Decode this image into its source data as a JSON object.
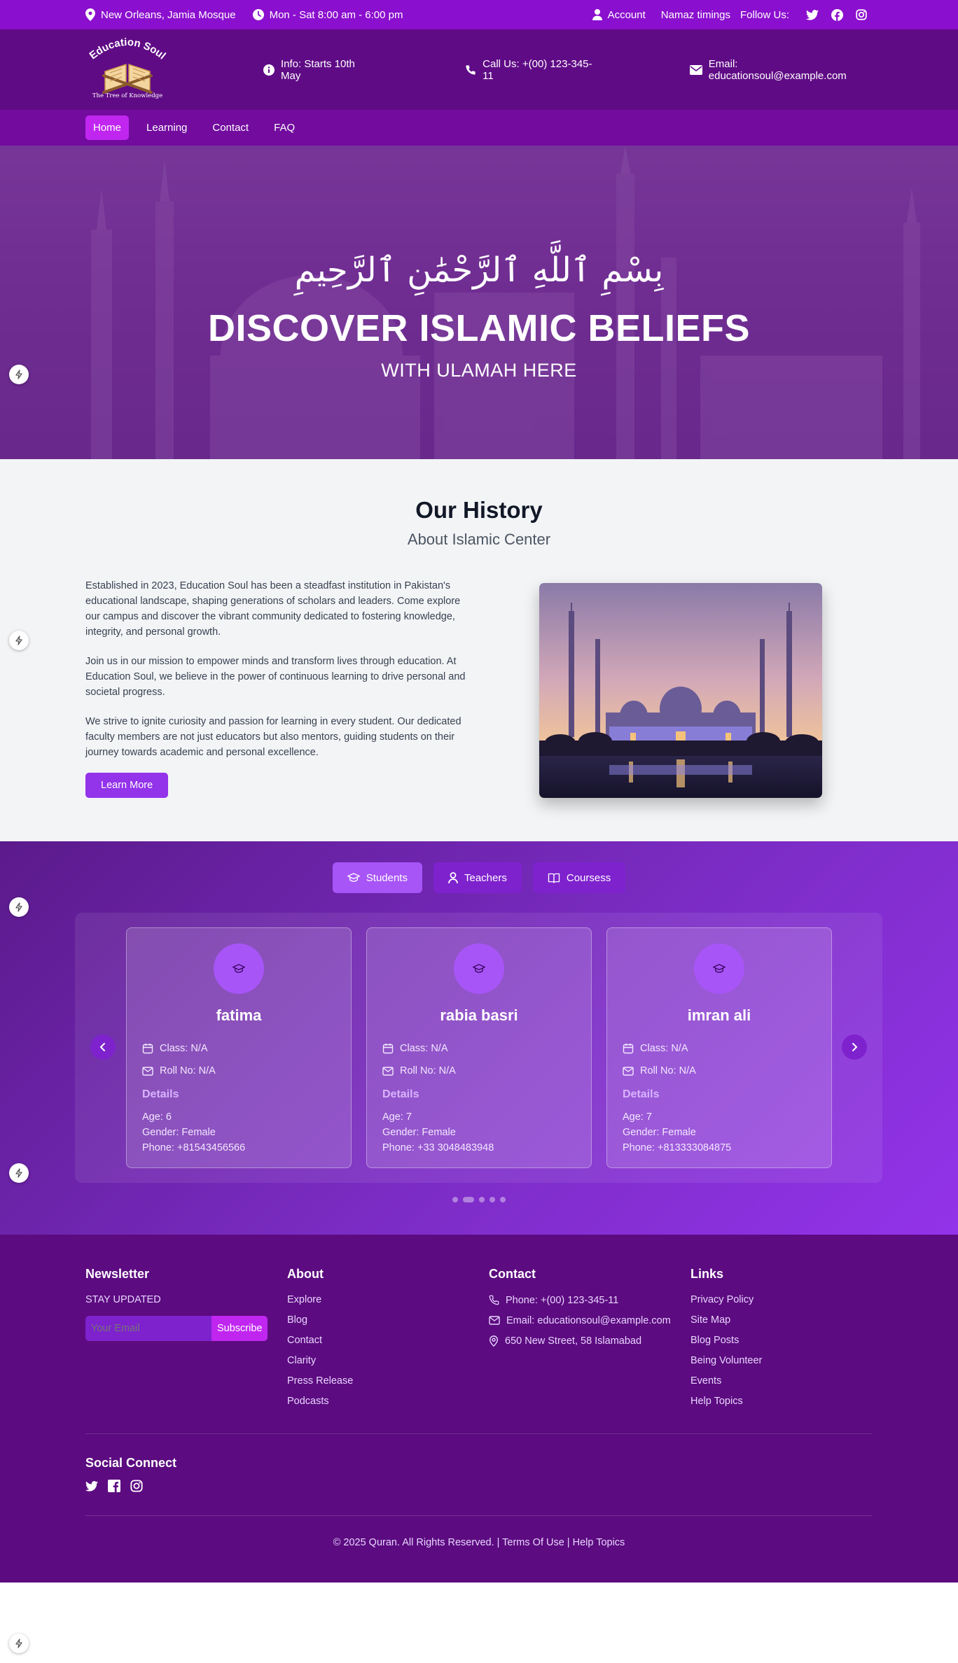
{
  "topbar": {
    "location": "New Orleans, Jamia Mosque",
    "hours": "Mon - Sat 8:00 am - 6:00 pm",
    "account": "Account",
    "namaz": "Namaz timings",
    "follow": "Follow Us:"
  },
  "logo": {
    "name": "Education Soul",
    "tagline": "The Tree of Knowledge"
  },
  "header": {
    "info": "Info: Starts 10th May",
    "call": "Call Us: +(00) 123-345-11",
    "email": "Email: educationsoul@example.com"
  },
  "nav": {
    "items": [
      "Home",
      "Learning",
      "Contact",
      "FAQ"
    ]
  },
  "hero": {
    "arabic": "بِسْمِ ٱللَّهِ ٱلرَّحْمَٰنِ ٱلرَّحِيمِ",
    "title": "DISCOVER ISLAMIC BELIEFS",
    "subtitle": "WITH ULAMAH HERE"
  },
  "history": {
    "title": "Our History",
    "subtitle": "About Islamic Center",
    "paragraphs": [
      "Established in 2023, Education Soul has been a steadfast institution in Pakistan's educational landscape, shaping generations of scholars and leaders. Come explore our campus and discover the vibrant community dedicated to fostering knowledge, integrity, and personal growth.",
      "Join us in our mission to empower minds and transform lives through education. At Education Soul, we believe in the power of continuous learning to drive personal and societal progress.",
      "We strive to ignite curiosity and passion for learning in every student. Our dedicated faculty members are not just educators but also mentors, guiding students on their journey towards academic and personal excellence."
    ],
    "button": "Learn More"
  },
  "people": {
    "tabs": [
      "Students",
      "Teachers",
      "Coursess"
    ],
    "details_label": "Details",
    "cards": [
      {
        "name": "fatima",
        "class": "Class: N/A",
        "roll": "Roll No: N/A",
        "age": "Age: 6",
        "gender": "Gender: Female",
        "phone": "Phone: +81543456566"
      },
      {
        "name": "rabia basri",
        "class": "Class: N/A",
        "roll": "Roll No: N/A",
        "age": "Age: 7",
        "gender": "Gender: Female",
        "phone": "Phone: +33 3048483948"
      },
      {
        "name": "imran ali",
        "class": "Class: N/A",
        "roll": "Roll No: N/A",
        "age": "Age: 7",
        "gender": "Gender: Female",
        "phone": "Phone: +813333084875"
      }
    ]
  },
  "footer": {
    "newsletter": {
      "title": "Newsletter",
      "tagline": "STAY UPDATED",
      "placeholder": "Your Email",
      "button": "Subscribe"
    },
    "about": {
      "title": "About",
      "links": [
        "Explore",
        "Blog",
        "Contact",
        "Clarity",
        "Press Release",
        "Podcasts"
      ]
    },
    "contact": {
      "title": "Contact",
      "phone": "Phone: +(00) 123-345-11",
      "email": "Email: educationsoul@example.com",
      "address": "650 New Street, 58 Islamabad"
    },
    "links": {
      "title": "Links",
      "items": [
        "Privacy Policy",
        "Site Map",
        "Blog Posts",
        "Being Volunteer",
        "Events",
        "Help Topics"
      ]
    },
    "social_title": "Social Connect",
    "copyright": "© 2025 Quran. All Rights Reserved. | Terms Of Use | Help Topics"
  },
  "colors": {
    "topbar": "#8b0fce",
    "header": "#600b86",
    "nav": "#720b9e",
    "accent": "#9333ea",
    "footer": "#5c0b80"
  }
}
